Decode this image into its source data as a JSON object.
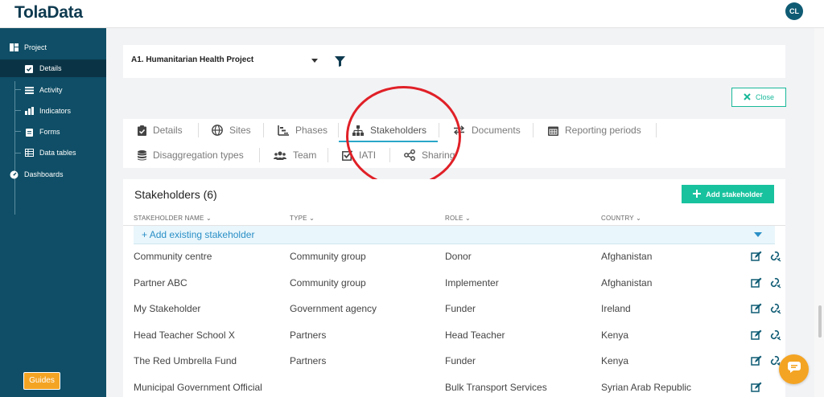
{
  "app": {
    "logo": "TolaData",
    "user_initials": "CL"
  },
  "sidebar": {
    "items": [
      {
        "label": "Project",
        "icon": "layout-icon"
      },
      {
        "label": "Details",
        "icon": "clipboard-check-icon",
        "active": true
      },
      {
        "label": "Activity",
        "icon": "list-icon"
      },
      {
        "label": "Indicators",
        "icon": "bar-chart-icon"
      },
      {
        "label": "Forms",
        "icon": "clipboard-icon"
      },
      {
        "label": "Data tables",
        "icon": "table-icon"
      },
      {
        "label": "Dashboards",
        "icon": "dashboard-icon"
      }
    ],
    "guides_label": "Guides"
  },
  "project": {
    "selected": "A1. Humanitarian Health Project"
  },
  "close_label": "Close",
  "tabs": [
    {
      "label": "Details",
      "icon": "clipboard-check-icon"
    },
    {
      "label": "Sites",
      "icon": "globe-icon"
    },
    {
      "label": "Phases",
      "icon": "phases-icon"
    },
    {
      "label": "Stakeholders",
      "icon": "sitemap-icon",
      "active": true
    },
    {
      "label": "Documents",
      "icon": "exchange-icon"
    },
    {
      "label": "Reporting periods",
      "icon": "calendar-icon"
    },
    {
      "label": "Disaggregation types",
      "icon": "database-icon"
    },
    {
      "label": "Team",
      "icon": "users-icon"
    },
    {
      "label": "IATI",
      "icon": "check-square-icon"
    },
    {
      "label": "Sharing",
      "icon": "share-icon"
    }
  ],
  "stakeholders": {
    "title": "Stakeholders (6)",
    "add_label": "Add stakeholder",
    "add_existing_label": "Add existing stakeholder",
    "columns": [
      "STAKEHOLDER NAME",
      "TYPE",
      "ROLE",
      "COUNTRY"
    ],
    "rows": [
      {
        "name": "Community centre",
        "type": "Community group",
        "role": "Donor",
        "country": "Afghanistan"
      },
      {
        "name": "Partner ABC",
        "type": "Community group",
        "role": "Implementer",
        "country": "Afghanistan"
      },
      {
        "name": "My Stakeholder",
        "type": "Government agency",
        "role": "Funder",
        "country": "Ireland"
      },
      {
        "name": "Head Teacher School X",
        "type": "Partners",
        "role": "Head Teacher",
        "country": "Kenya"
      },
      {
        "name": "The Red Umbrella Fund",
        "type": "Partners",
        "role": "Funder",
        "country": "Kenya"
      },
      {
        "name": "Municipal Government Official",
        "type": "",
        "role": "Bulk Transport Services",
        "country": "Syrian Arab Republic"
      }
    ]
  },
  "colors": {
    "sidebar": "#0f4e66",
    "accent": "#19c29e",
    "link": "#2a8fc7",
    "guides": "#f4a423",
    "highlight": "#e02027"
  }
}
